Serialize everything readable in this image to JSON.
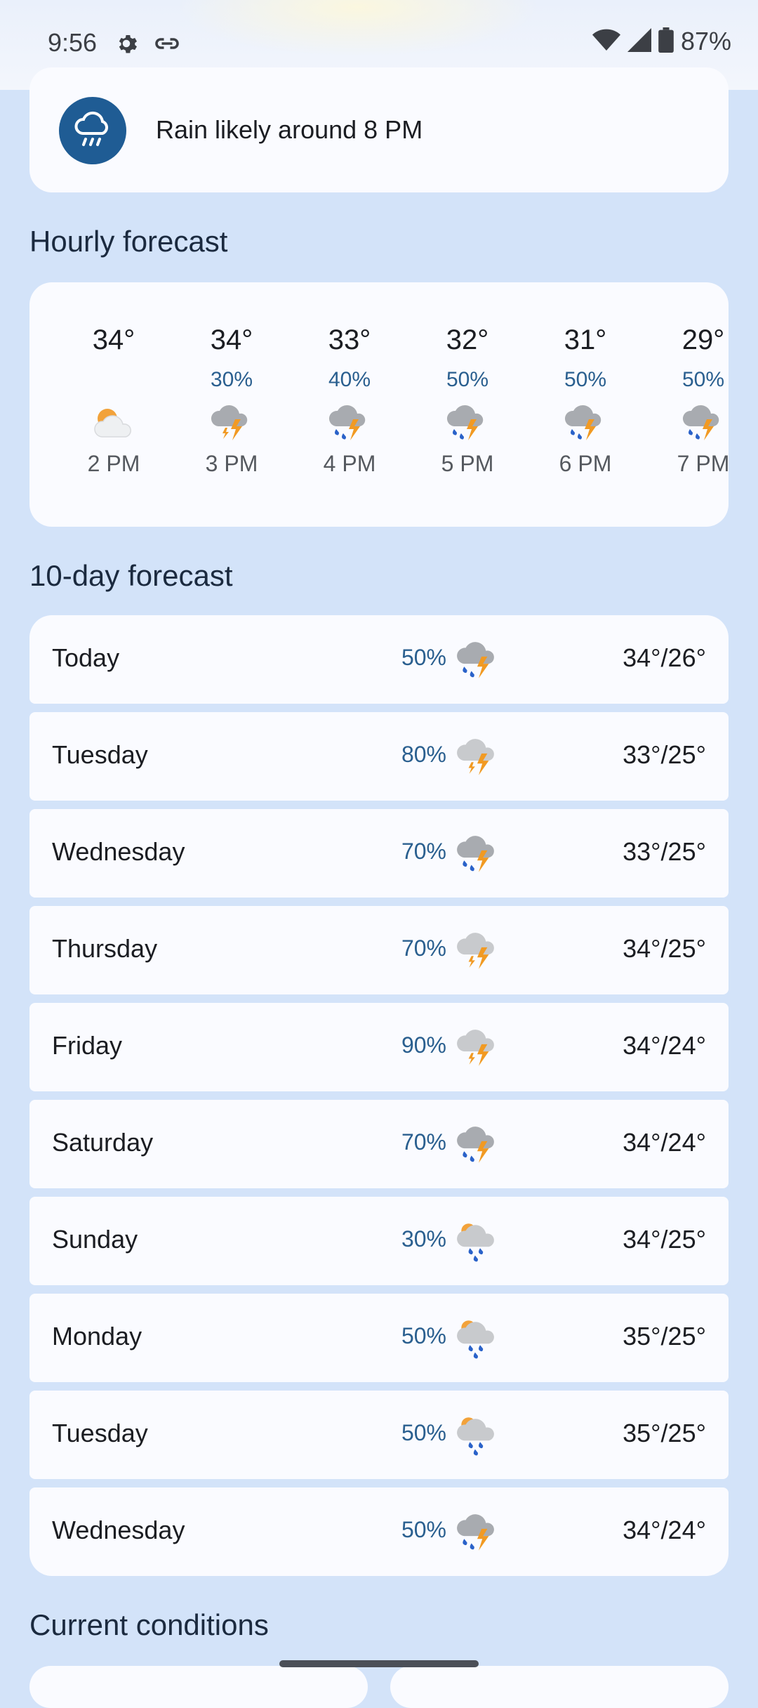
{
  "status_bar": {
    "time": "9:56",
    "battery": "87%",
    "icons": [
      "settings-gear-icon",
      "link-icon",
      "wifi-icon",
      "signal-icon",
      "battery-icon"
    ]
  },
  "rain_alert": {
    "text": "Rain likely around 8 PM",
    "icon": "rain-cloud-icon"
  },
  "hourly": {
    "title": "Hourly forecast",
    "items": [
      {
        "temp": "34°",
        "precip": "",
        "time": "2 PM",
        "icon": "partly-cloudy"
      },
      {
        "temp": "34°",
        "precip": "30%",
        "time": "3 PM",
        "icon": "thunderstorm"
      },
      {
        "temp": "33°",
        "precip": "40%",
        "time": "4 PM",
        "icon": "thunderstorm-rain"
      },
      {
        "temp": "32°",
        "precip": "50%",
        "time": "5 PM",
        "icon": "thunderstorm-rain"
      },
      {
        "temp": "31°",
        "precip": "50%",
        "time": "6 PM",
        "icon": "thunderstorm-rain"
      },
      {
        "temp": "29°",
        "precip": "50%",
        "time": "7 PM",
        "icon": "thunderstorm-rain"
      }
    ]
  },
  "daily": {
    "title": "10-day forecast",
    "items": [
      {
        "day": "Today",
        "precip": "50%",
        "temps": "34°/26°",
        "icon": "thunderstorm-rain"
      },
      {
        "day": "Tuesday",
        "precip": "80%",
        "temps": "33°/25°",
        "icon": "thunderstorm"
      },
      {
        "day": "Wednesday",
        "precip": "70%",
        "temps": "33°/25°",
        "icon": "thunderstorm-rain"
      },
      {
        "day": "Thursday",
        "precip": "70%",
        "temps": "34°/25°",
        "icon": "thunderstorm"
      },
      {
        "day": "Friday",
        "precip": "90%",
        "temps": "34°/24°",
        "icon": "thunderstorm"
      },
      {
        "day": "Saturday",
        "precip": "70%",
        "temps": "34°/24°",
        "icon": "thunderstorm-rain"
      },
      {
        "day": "Sunday",
        "precip": "30%",
        "temps": "34°/25°",
        "icon": "showers"
      },
      {
        "day": "Monday",
        "precip": "50%",
        "temps": "35°/25°",
        "icon": "showers"
      },
      {
        "day": "Tuesday",
        "precip": "50%",
        "temps": "35°/25°",
        "icon": "showers"
      },
      {
        "day": "Wednesday",
        "precip": "50%",
        "temps": "34°/24°",
        "icon": "thunderstorm-rain"
      }
    ]
  },
  "current_conditions": {
    "title": "Current conditions"
  }
}
